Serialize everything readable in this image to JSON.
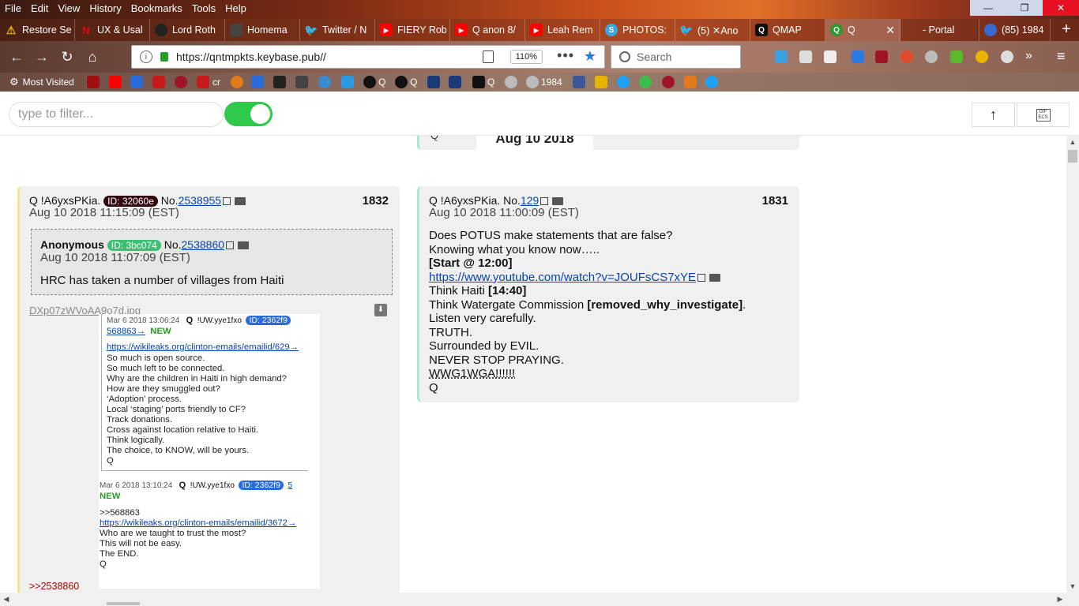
{
  "window": {
    "menu": [
      "File",
      "Edit",
      "View",
      "History",
      "Bookmarks",
      "Tools",
      "Help"
    ],
    "controls": {
      "minimize": "—",
      "maximize": "❐",
      "close": "✕"
    }
  },
  "tabs": [
    {
      "label": "Restore Se",
      "icon": "warning-icon",
      "color": "#e8b400"
    },
    {
      "label": "UX & Usal",
      "icon": "netflix-icon",
      "color": "#e50914"
    },
    {
      "label": "Lord Roth",
      "icon": "lord-icon",
      "color": "#222222"
    },
    {
      "label": "Homema",
      "icon": "site-icon",
      "color": "#444444"
    },
    {
      "label": "Twitter / N",
      "icon": "twitter-icon",
      "color": "#1da1f2"
    },
    {
      "label": "FIERY Rob",
      "icon": "youtube-icon",
      "color": "#ff0000"
    },
    {
      "label": "Q anon 8/",
      "icon": "youtube-icon",
      "color": "#ff0000"
    },
    {
      "label": "Leah Rem",
      "icon": "youtube-icon",
      "color": "#ff0000"
    },
    {
      "label": "PHOTOS:",
      "icon": "s-icon",
      "color": "#3aa7e0"
    },
    {
      "label": "(5) ✕Ano",
      "icon": "twitter-icon",
      "color": "#1da1f2"
    },
    {
      "label": "QMAP",
      "icon": "q-icon",
      "color": "#111111"
    },
    {
      "label": "Q",
      "icon": "q-green-icon",
      "color": "#2a9a2a"
    },
    {
      "label": "- Portal",
      "icon": "blank-icon",
      "color": "#ffffff"
    },
    {
      "label": "(85) 1984",
      "icon": "globe-icon",
      "color": "#3a6ad0"
    }
  ],
  "navbar": {
    "url": "https://qntmpkts.keybase.pub//",
    "zoom": "110%",
    "search_placeholder": "Search"
  },
  "bookmarks": {
    "most_visited": "Most Visited",
    "items": [
      "cr",
      "Q",
      "Q",
      "Q",
      "1984"
    ]
  },
  "page": {
    "filter_placeholder": "type to filter...",
    "up_arrow": "↑",
    "gif_label": "GIF ECS",
    "date_header": "Aug 10 2018",
    "date_header_sig": "Q"
  },
  "post1832": {
    "author": "Q !A6yxsPKia.",
    "id_badge": "ID: 32060e",
    "no_label": "No.",
    "no_link": "2538955",
    "number": "1832",
    "date": "Aug 10 2018 11:15:09 (EST)",
    "quote": {
      "author": "Anonymous",
      "id_badge": "ID: 3bc074",
      "no_label": "No.",
      "no_link": "2538860",
      "date": "Aug 10 2018 11:07:09 (EST)",
      "text": "HRC has taken a number of villages from Haiti"
    },
    "filename": "DXp07zWVoAA9o7d.jpg",
    "screenshot": {
      "a_date": "Mar 6 2018 13:06:24",
      "a_q": "Q",
      "a_trip": "!UW.yye1fxo",
      "a_id": "ID: 2362f9",
      "a_link": "568863→",
      "a_new": "NEW",
      "a_url": "https://wikileaks.org/clinton-emails/emailid/629→",
      "a_lines": [
        "So much is open source.",
        "So much left to be connected.",
        "Why are the children in Haiti in high demand?",
        "How are they smuggled out?",
        "‘Adoption’ process.",
        "Local ‘staging’ ports friendly to CF?",
        "Track donations.",
        "Cross against location relative to Haiti.",
        "Think logically.",
        "The choice, to KNOW, will be yours.",
        "Q"
      ],
      "b_date": "Mar 6 2018 13:10:24",
      "b_q": "Q",
      "b_trip": "!UW.yye1fxo",
      "b_id": "ID: 2362f9",
      "b_five": "5",
      "b_new": "NEW",
      "b_ref": ">>568863",
      "b_url": "https://wikileaks.org/clinton-emails/emailid/3672→",
      "b_lines": [
        "Who are we taught to trust the most?",
        "This will not be easy.",
        "The END.",
        "Q"
      ]
    },
    "backlink": ">>2538860"
  },
  "post1831": {
    "author": "Q !A6yxsPKia.",
    "no_label": "No.",
    "no_link": "129",
    "number": "1831",
    "date": "Aug 10 2018 11:00:09 (EST)",
    "lines": {
      "l1": "Does POTUS make statements that are false?",
      "l2": "Knowing what you know now…..",
      "l3": "[Start @ 12:00]",
      "l4": "https://www.youtube.com/watch?v=JOUFsCS7xYE",
      "l5a": "Think Haiti ",
      "l5b": "[14:40]",
      "l6a": "Think Watergate Commission ",
      "l6b": "[removed_why_investigate]",
      "l6c": ".",
      "l7": "Listen very carefully.",
      "l8": "TRUTH.",
      "l9": "Surrounded by EVIL.",
      "l10": "NEVER STOP PRAYING.",
      "l11": "WWG1WGA!!!!!!",
      "l12": "Q"
    }
  },
  "colors": {
    "toggle_on": "#2ec84a",
    "id_32060e_bg": "#32060e",
    "id_3bc074_bg": "#3bc074",
    "id_2362f9_bg": "#2362f9",
    "accent_left_1832": "#f0e68c",
    "accent_left_1831": "#a7e8d5"
  }
}
